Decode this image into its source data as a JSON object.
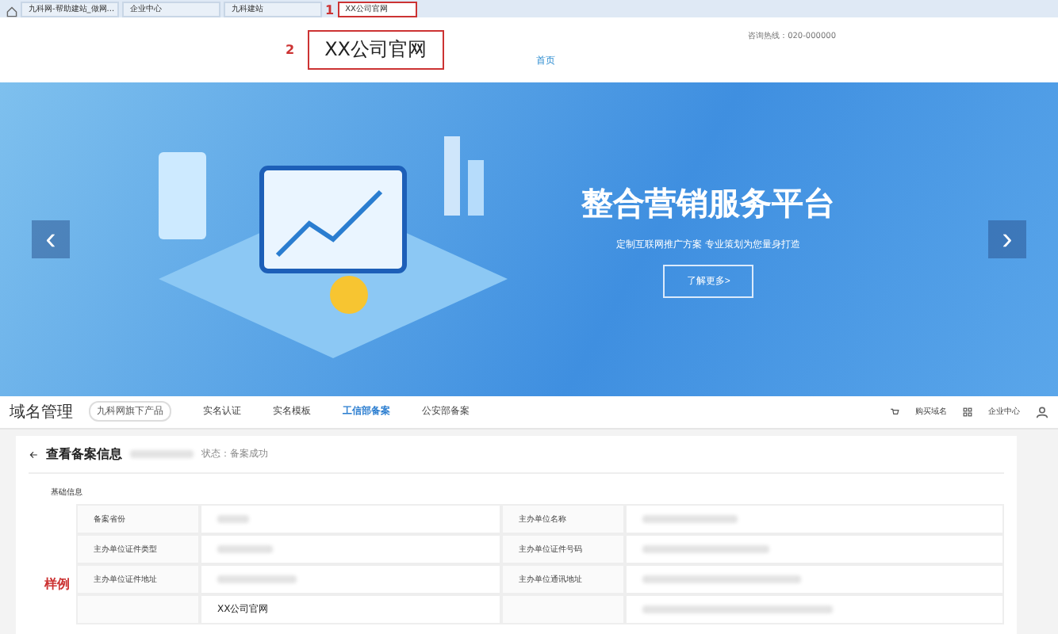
{
  "browser_tabs": [
    {
      "title": "九科网-帮助建站_做网...",
      "selected": false
    },
    {
      "title": "企业中心",
      "selected": false
    },
    {
      "title": "九科建站",
      "selected": false
    },
    {
      "title": "XX公司官网",
      "selected": true
    }
  ],
  "tab_marker": "1",
  "site_header": {
    "marker": "2",
    "logo_text": "XX公司官网",
    "hotline": "咨询热线：020-000000",
    "nav": [
      {
        "label": "首页",
        "selected": true
      }
    ]
  },
  "banner": {
    "title": "整合营销服务平台",
    "subtitle": "定制互联网推广方案  专业策划为您量身打造",
    "button": "了解更多>",
    "prev": "‹",
    "next": "›"
  },
  "domain_nav": {
    "logo": "域名管理",
    "tag": "九科网旗下产品",
    "items": [
      {
        "label": "实名认证",
        "selected": false
      },
      {
        "label": "实名模板",
        "selected": false
      },
      {
        "label": "工信部备案",
        "selected": true
      },
      {
        "label": "公安部备案",
        "selected": false
      }
    ],
    "actions": [
      "购买域名",
      "企业中心"
    ]
  },
  "record": {
    "title": "查看备案信息",
    "status": "状态：备案成功",
    "section": "基础信息",
    "sample_label": "样例",
    "rows": [
      {
        "label_1": "备案省份",
        "label_2": "主办单位名称"
      },
      {
        "label_1": "主办单位证件类型",
        "label_2": "主办单位证件号码"
      },
      {
        "label_1": "主办单位证件地址",
        "label_2": "主办单位通讯地址"
      },
      {
        "label_1": "",
        "value_1": "XX公司官网",
        "label_2": ""
      }
    ]
  }
}
